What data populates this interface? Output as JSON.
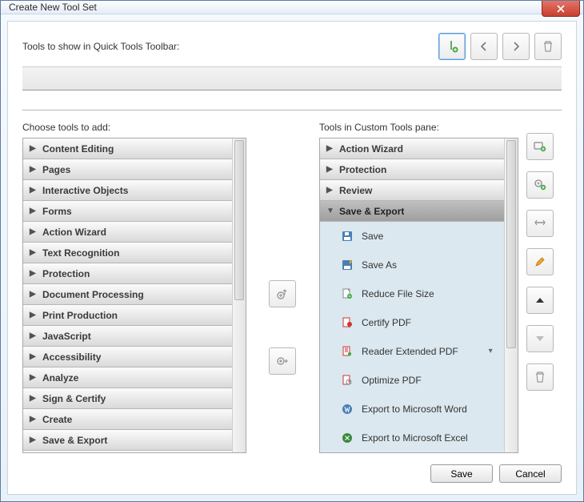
{
  "window": {
    "title": "Create New Tool Set"
  },
  "quickTools": {
    "label": "Tools to show in Quick Tools Toolbar:",
    "buttons": {
      "addDivider": "add-divider",
      "prev": "previous",
      "next": "next",
      "delete": "delete"
    }
  },
  "left": {
    "label": "Choose tools to add:",
    "categories": [
      {
        "label": "Content Editing"
      },
      {
        "label": "Pages"
      },
      {
        "label": "Interactive Objects"
      },
      {
        "label": "Forms"
      },
      {
        "label": "Action Wizard"
      },
      {
        "label": "Text Recognition"
      },
      {
        "label": "Protection"
      },
      {
        "label": "Document Processing"
      },
      {
        "label": "Print Production"
      },
      {
        "label": "JavaScript"
      },
      {
        "label": "Accessibility"
      },
      {
        "label": "Analyze"
      },
      {
        "label": "Sign & Certify"
      },
      {
        "label": "Create"
      },
      {
        "label": "Save & Export"
      }
    ]
  },
  "right": {
    "label": "Tools in Custom Tools pane:",
    "categories": [
      {
        "label": "Action Wizard",
        "expanded": false
      },
      {
        "label": "Protection",
        "expanded": false
      },
      {
        "label": "Review",
        "expanded": false
      },
      {
        "label": "Save & Export",
        "expanded": true
      }
    ],
    "tools": [
      {
        "label": "Save",
        "icon": "save"
      },
      {
        "label": "Save As",
        "icon": "save-as"
      },
      {
        "label": "Reduce File Size",
        "icon": "reduce"
      },
      {
        "label": "Certify PDF",
        "icon": "certify"
      },
      {
        "label": "Reader Extended PDF",
        "icon": "reader-ext",
        "hasSub": true
      },
      {
        "label": "Optimize PDF",
        "icon": "optimize"
      },
      {
        "label": "Export to Microsoft Word",
        "icon": "export-word"
      },
      {
        "label": "Export to Microsoft Excel",
        "icon": "export-excel"
      }
    ]
  },
  "midButtons": {
    "addUp": "add-to-toolbar",
    "addRight": "add-to-pane"
  },
  "actionButtons": {
    "addPanel": "add-panel",
    "addTool": "add-tool",
    "addDivider": "add-divider",
    "rename": "rename",
    "moveUp": "move-up",
    "moveDown": "move-down",
    "delete": "delete"
  },
  "footer": {
    "save": "Save",
    "cancel": "Cancel"
  }
}
